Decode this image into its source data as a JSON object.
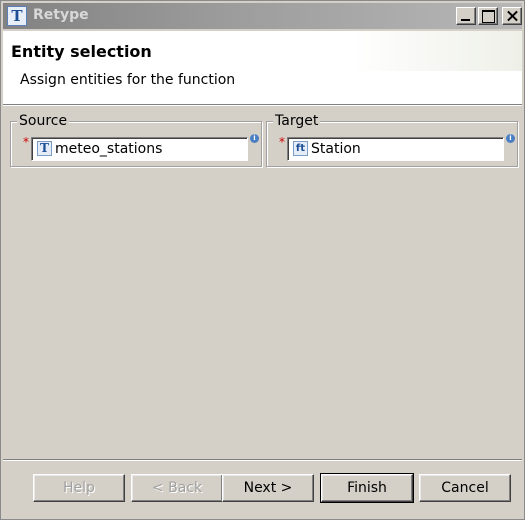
{
  "window": {
    "title": "Retype",
    "icon_glyph": "T"
  },
  "header": {
    "title": "Entity selection",
    "description": "Assign entities for the function"
  },
  "source": {
    "legend": "Source",
    "required_marker": "*",
    "icon_glyph": "T",
    "value": "meteo_stations",
    "info_glyph": "i"
  },
  "target": {
    "legend": "Target",
    "required_marker": "*",
    "icon_glyph": "ft",
    "value": "Station",
    "info_glyph": "i"
  },
  "buttons": {
    "help": "Help",
    "back": "< Back",
    "next": "Next >",
    "finish": "Finish",
    "cancel": "Cancel"
  },
  "colors": {
    "dialog_bg": "#d4d0c8",
    "title_bar": "#9d9d9d",
    "required": "#d00000",
    "info": "#4a7fc4"
  }
}
